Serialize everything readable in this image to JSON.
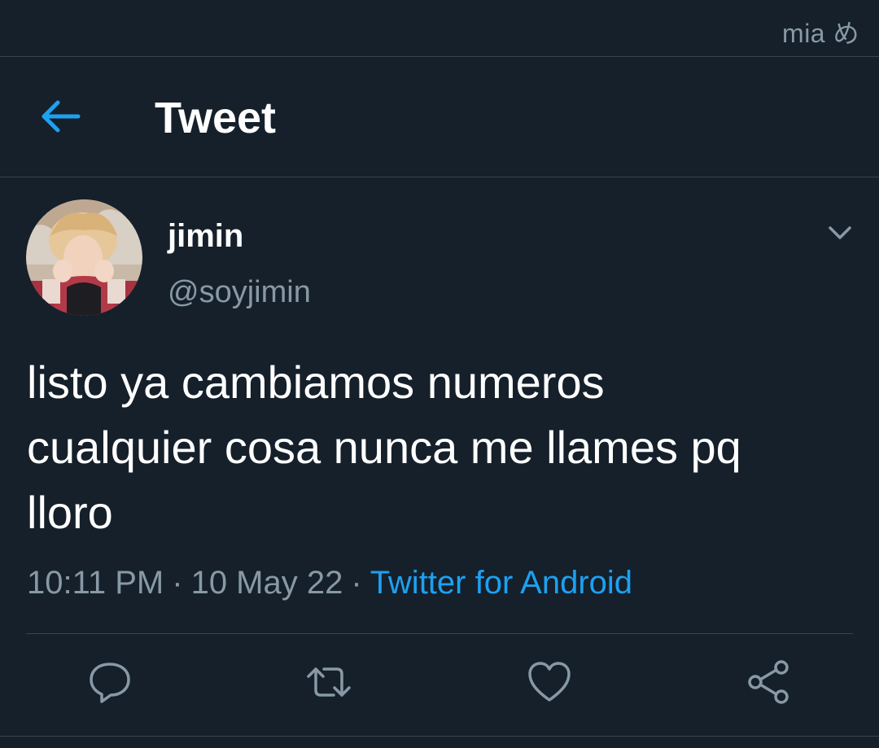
{
  "watermark": "mia め",
  "header": {
    "back_icon": "arrow-left-icon",
    "title": "Tweet"
  },
  "tweet": {
    "author": {
      "display_name": "jimin",
      "handle": "@soyjimin",
      "avatar_icon": "user-avatar"
    },
    "more_icon": "chevron-down-icon",
    "text_lines": [
      "listo ya cambiamos numeros",
      "cualquier cosa nunca me llames pq",
      "lloro"
    ],
    "time": "10:11 PM",
    "separator": "·",
    "date": "10 May 22",
    "source": "Twitter for Android"
  },
  "actions": {
    "reply_icon": "reply-icon",
    "retweet_icon": "retweet-icon",
    "like_icon": "heart-icon",
    "share_icon": "share-icon"
  },
  "colors": {
    "background": "#15202b",
    "divider": "#38444d",
    "secondary_text": "#8899a6",
    "accent": "#1da1f2",
    "primary_text": "#ffffff"
  }
}
